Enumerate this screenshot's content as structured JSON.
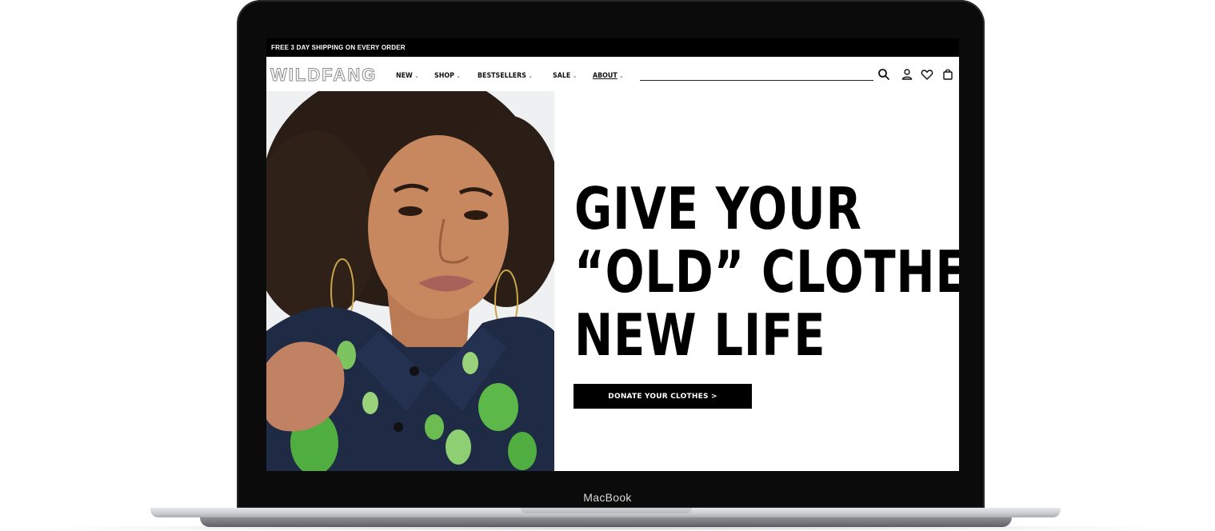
{
  "device": {
    "label": "MacBook"
  },
  "promo": {
    "text": "FREE 3 DAY SHIPPING ON EVERY ORDER"
  },
  "header": {
    "logo": "WILDFANG",
    "nav": [
      {
        "label": "NEW"
      },
      {
        "label": "SHOP"
      },
      {
        "label": "BESTSELLERS"
      },
      {
        "label": "SALE"
      },
      {
        "label": "ABOUT"
      }
    ],
    "search": {
      "value": "",
      "placeholder": ""
    },
    "icons": [
      "search-icon",
      "account-icon",
      "wishlist-icon",
      "cart-icon"
    ]
  },
  "hero": {
    "headline": [
      "GIVE YOUR",
      "“OLD” CLOTHES",
      "NEW LIFE"
    ],
    "cta_label": "DONATE YOUR CLOTHES >"
  },
  "colors": {
    "brand": "#000000",
    "background": "#ffffff",
    "shirt": "#1f2a44",
    "leaf": "#3f9a3a"
  }
}
